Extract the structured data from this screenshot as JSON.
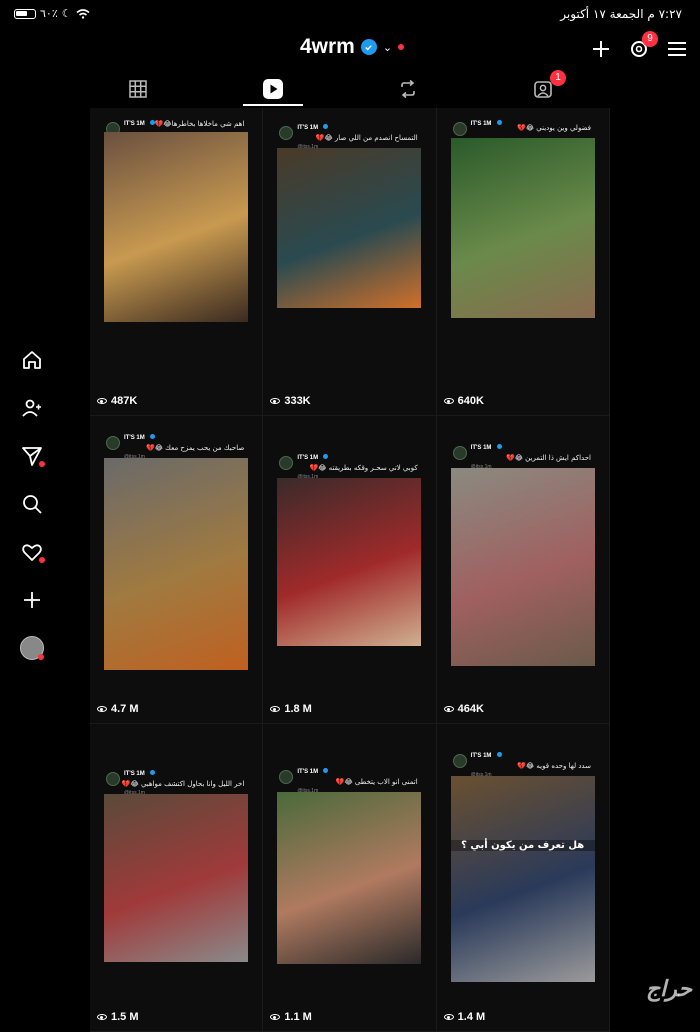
{
  "status_bar": {
    "battery": "٦٠٪",
    "datetime": "٧:٢٧ م  الجمعة ١٧ أكتوبر"
  },
  "header": {
    "username": "4wrm",
    "notif_count": "9"
  },
  "tabs": [
    {
      "icon": "grid-icon"
    },
    {
      "icon": "reels-icon",
      "active": true
    },
    {
      "icon": "repost-icon"
    },
    {
      "icon": "tagged-icon",
      "badge": "1"
    }
  ],
  "posts": [
    {
      "caption": "اهم شي ماخلاها بخاطرها😂💔",
      "views": "487K",
      "account": "IT'S 1M",
      "handle": "@itss.1m",
      "colors": [
        "#6a5040",
        "#c89a50",
        "#3a2a20"
      ]
    },
    {
      "caption": "التمساح انصدم من اللي صار 😂💔",
      "views": "333K",
      "account": "IT'S 1M",
      "handle": "@itss.1m",
      "colors": [
        "#4a3a28",
        "#2a4a50",
        "#d0702a"
      ]
    },
    {
      "caption": "فضولي وين يوديني 😂💔",
      "views": "640K",
      "account": "IT'S 1M",
      "handle": "@itss.1m",
      "colors": [
        "#2a5a2a",
        "#6a8a4a",
        "#8a6a50"
      ]
    },
    {
      "caption": "صاحبك من يحب يمزح معك 😂💔",
      "views": "4.7 M",
      "account": "IT'S 1M",
      "handle": "@itss.1m",
      "colors": [
        "#6a6a6a",
        "#a07a40",
        "#c06020"
      ]
    },
    {
      "caption": "كوبي لاتي سحـر وقكه بطريقته 😂💔",
      "views": "1.8 M",
      "account": "IT'S 1M",
      "handle": "@itss.1m",
      "colors": [
        "#3a2a2a",
        "#a02a2a",
        "#d0b090"
      ]
    },
    {
      "caption": "احداكم ايش ذا التمرين 😂💔",
      "views": "464K",
      "account": "IT'S 1M",
      "handle": "@itss.1m",
      "colors": [
        "#8a8a80",
        "#a06060",
        "#6a5a4a"
      ]
    },
    {
      "caption": "اخر الليل وانا بحاول اكتشف مواهبي 😂💔",
      "views": "1.5 M",
      "account": "IT'S 1M",
      "handle": "@itss.1m",
      "colors": [
        "#5a4a3a",
        "#a03a3a",
        "#8a8a8a"
      ]
    },
    {
      "caption": "اتمنى انو الاب يتخطى 😂💔",
      "views": "1.1 M",
      "account": "IT'S 1M",
      "handle": "@itss.1m",
      "colors": [
        "#4a6a3a",
        "#b07a60",
        "#2a2a2a"
      ]
    },
    {
      "caption": "سدد لها وحده قويه 😂💔",
      "views": "1.4 M",
      "account": "IT'S 1M",
      "handle": "@itss.1m",
      "colors": [
        "#6a5030",
        "#2a3a5a",
        "#9a9a9a"
      ],
      "overlay": "هل تعرف من يكون أبي ؟"
    }
  ],
  "watermark": "حراج"
}
